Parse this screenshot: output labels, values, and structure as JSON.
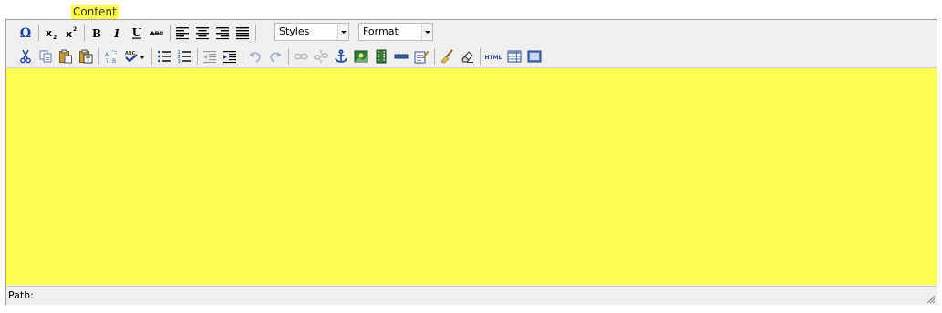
{
  "field": {
    "label": "Content"
  },
  "toolbar": {
    "styles_select": {
      "value": "Styles"
    },
    "format_select": {
      "value": "Format"
    },
    "row1": [
      {
        "name": "omega-icon",
        "title": "Insert custom character"
      },
      {
        "name": "subscript-icon",
        "title": "Subscript"
      },
      {
        "name": "superscript-icon",
        "title": "Superscript"
      },
      {
        "name": "bold-icon",
        "title": "Bold"
      },
      {
        "name": "italic-icon",
        "title": "Italic"
      },
      {
        "name": "underline-icon",
        "title": "Underline"
      },
      {
        "name": "strikethrough-icon",
        "title": "Strikethrough"
      },
      {
        "name": "align-left-icon",
        "title": "Align left"
      },
      {
        "name": "align-center-icon",
        "title": "Align center"
      },
      {
        "name": "align-right-icon",
        "title": "Align right"
      },
      {
        "name": "align-justify-icon",
        "title": "Align full"
      }
    ],
    "row2": [
      {
        "name": "cut-icon"
      },
      {
        "name": "copy-icon"
      },
      {
        "name": "paste-icon"
      },
      {
        "name": "paste-text-icon"
      },
      {
        "name": "find-replace-icon"
      },
      {
        "name": "spellcheck-icon"
      },
      {
        "name": "bullet-list-icon"
      },
      {
        "name": "numbered-list-icon"
      },
      {
        "name": "outdent-icon"
      },
      {
        "name": "indent-icon"
      },
      {
        "name": "undo-icon"
      },
      {
        "name": "redo-icon"
      },
      {
        "name": "link-icon"
      },
      {
        "name": "unlink-icon"
      },
      {
        "name": "anchor-icon"
      },
      {
        "name": "image-icon"
      },
      {
        "name": "media-icon"
      },
      {
        "name": "horizontal-rule-icon"
      },
      {
        "name": "edit-icon"
      },
      {
        "name": "cleanup-icon"
      },
      {
        "name": "remove-format-icon"
      },
      {
        "name": "html-icon"
      },
      {
        "name": "table-icon"
      },
      {
        "name": "fullscreen-icon"
      }
    ],
    "icon_text": {
      "html": "HTML"
    }
  },
  "status": {
    "path_label": "Path:"
  },
  "colors": {
    "content_bg": "#ffff55",
    "label_bg": "#ffff4f",
    "toolbar_bg": "#f0f0ee"
  }
}
